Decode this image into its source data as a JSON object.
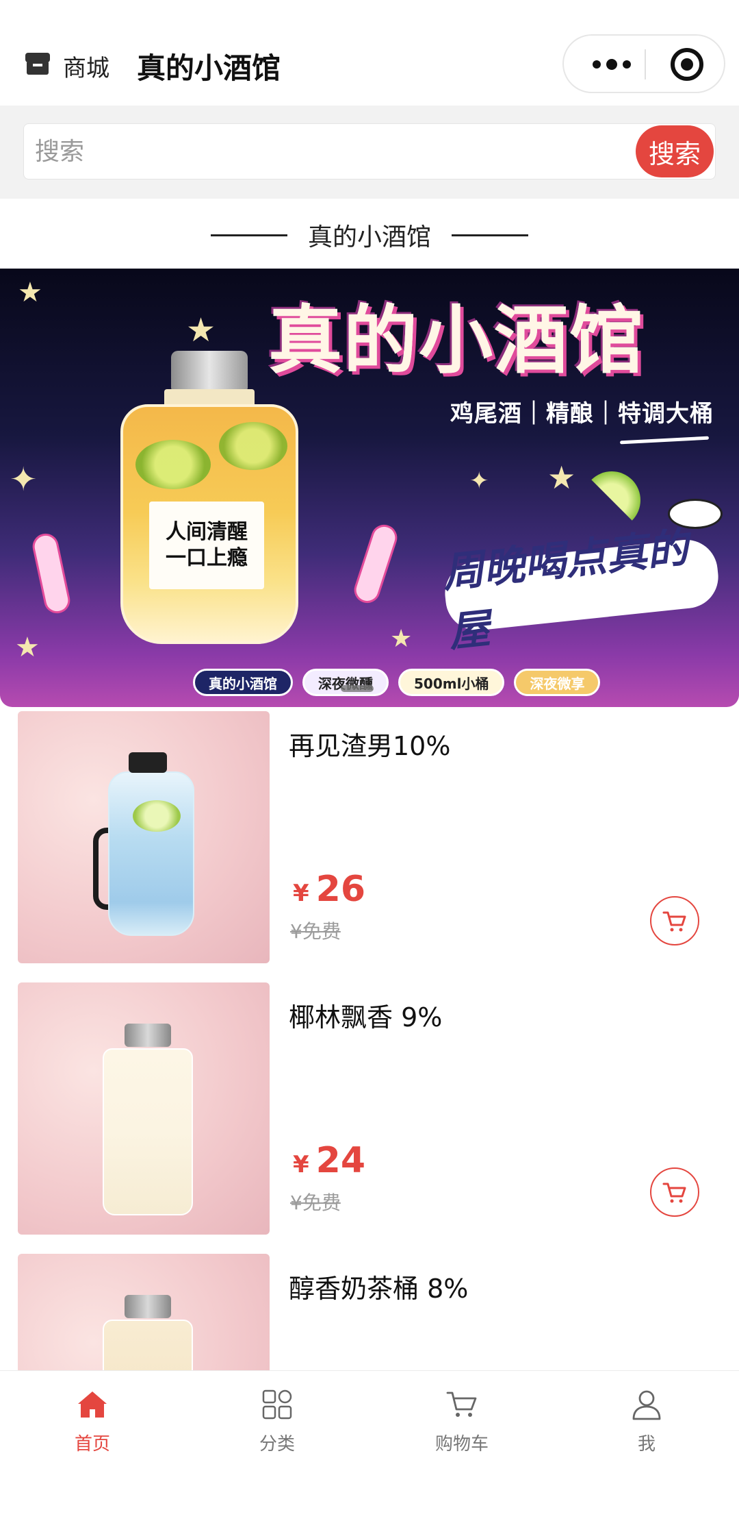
{
  "header": {
    "shop_label": "商城",
    "app_title": "真的小酒馆"
  },
  "search": {
    "placeholder": "搜索",
    "button_label": "搜索"
  },
  "section": {
    "title": "真的小酒馆"
  },
  "banner": {
    "title": "真的小酒馆",
    "subtitle": "鸡尾酒｜精酿｜特调大桶",
    "bottle_label_line1": "人间清醒",
    "bottle_label_line2": "一口上瘾",
    "script_text": "周晚喝点真的屋",
    "tags": [
      "真的小酒馆",
      "深夜微醺",
      "500ml小桶",
      "深夜微享"
    ]
  },
  "products": [
    {
      "name": "再见渣男10%",
      "currency": "¥",
      "price": "26",
      "original_price": "¥免费"
    },
    {
      "name": "椰林飘香 9%",
      "currency": "¥",
      "price": "24",
      "original_price": "¥免费"
    },
    {
      "name": "醇香奶茶桶 8%"
    }
  ],
  "tabbar": {
    "items": [
      {
        "label": "首页",
        "icon": "home-icon",
        "active": true
      },
      {
        "label": "分类",
        "icon": "category-grid-icon",
        "active": false
      },
      {
        "label": "购物车",
        "icon": "cart-icon",
        "active": false
      },
      {
        "label": "我",
        "icon": "user-icon",
        "active": false
      }
    ]
  },
  "colors": {
    "accent": "#e4463f",
    "tab_inactive": "#777777"
  }
}
